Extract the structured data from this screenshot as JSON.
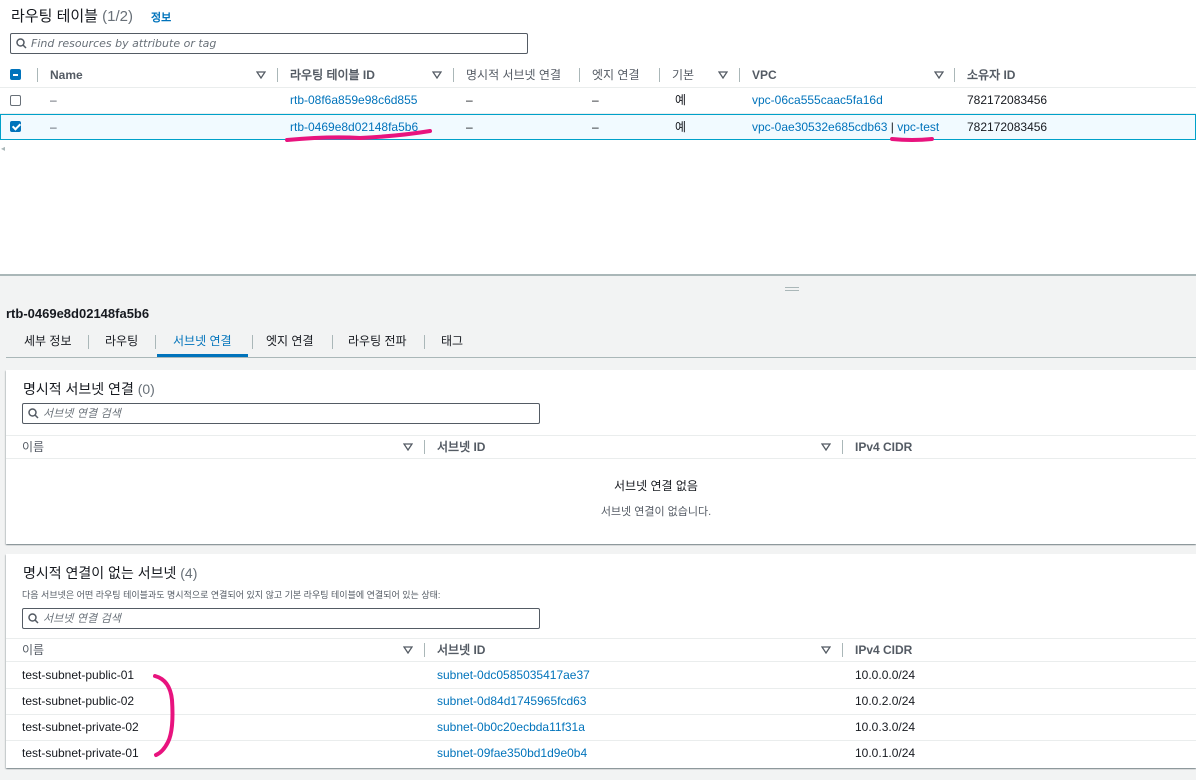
{
  "top": {
    "title": "라우팅 테이블",
    "count": "(1/2)",
    "info": "정보",
    "search_placeholder": "Find resources by attribute or tag",
    "columns": [
      "Name",
      "라우팅 테이블 ID",
      "명시적 서브넷 연결",
      "엣지 연결",
      "기본",
      "VPC",
      "소유자 ID"
    ],
    "rows": [
      {
        "name": "–",
        "id": "rtb-08f6a859e98c6d855",
        "explicit": "–",
        "edge": "–",
        "main": "예",
        "vpc": "vpc-06ca555caac5fa16d",
        "vpc_name": "",
        "owner": "782172083456",
        "selected": false
      },
      {
        "name": "–",
        "id": "rtb-0469e8d02148fa5b6",
        "explicit": "–",
        "edge": "–",
        "main": "예",
        "vpc": "vpc-0ae30532e685cdb63",
        "vpc_name": "vpc-test",
        "owner": "782172083456",
        "selected": true
      }
    ]
  },
  "detail": {
    "title": "rtb-0469e8d02148fa5b6",
    "tabs": [
      "세부 정보",
      "라우팅",
      "서브넷 연결",
      "엣지 연결",
      "라우팅 전파",
      "태그"
    ],
    "active_tab": "서브넷 연결"
  },
  "explicit": {
    "title": "명시적 서브넷 연결",
    "count": "(0)",
    "search_placeholder": "서브넷 연결 검색",
    "columns": [
      "이름",
      "서브넷 ID",
      "IPv4 CIDR"
    ],
    "empty_title": "서브넷 연결 없음",
    "empty_desc": "서브넷 연결이 없습니다."
  },
  "implicit": {
    "title": "명시적 연결이 없는 서브넷",
    "count": "(4)",
    "description": "다음 서브넷은 어떤 라우팅 테이블과도 명시적으로 연결되어 있지 않고 기본 라우팅 테이블에 연결되어 있는 상태:",
    "search_placeholder": "서브넷 연결 검색",
    "columns": [
      "이름",
      "서브넷 ID",
      "IPv4 CIDR"
    ],
    "rows": [
      {
        "name": "test-subnet-public-01",
        "subnet": "subnet-0dc0585035417ae37",
        "cidr": "10.0.0.0/24"
      },
      {
        "name": "test-subnet-public-02",
        "subnet": "subnet-0d84d1745965fcd63",
        "cidr": "10.0.2.0/24"
      },
      {
        "name": "test-subnet-private-02",
        "subnet": "subnet-0b0c20ecbda11f31a",
        "cidr": "10.0.3.0/24"
      },
      {
        "name": "test-subnet-private-01",
        "subnet": "subnet-09fae350bd1d9e0b4",
        "cidr": "10.0.1.0/24"
      }
    ]
  },
  "colors": {
    "link": "#0073bb",
    "annotation": "#e8137e",
    "selected_border": "#00a1c9"
  }
}
